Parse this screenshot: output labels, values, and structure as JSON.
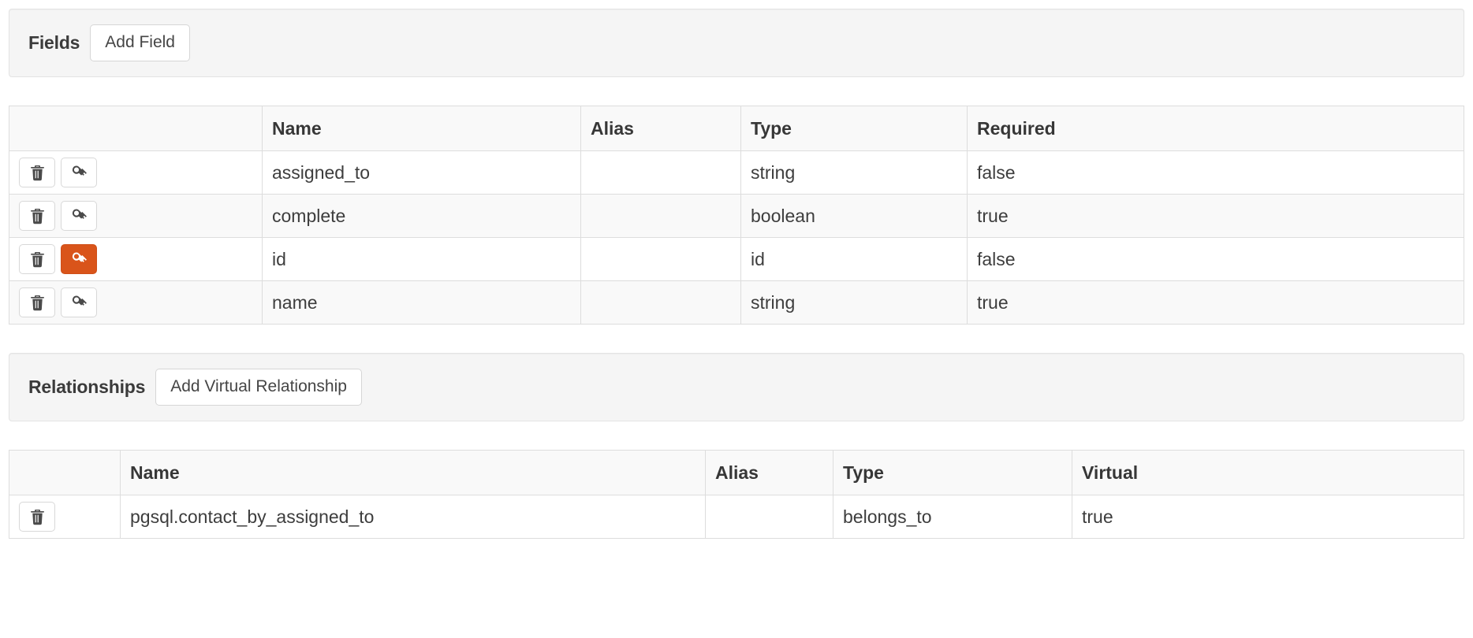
{
  "fields_section": {
    "title": "Fields",
    "add_button_label": "Add Field",
    "table": {
      "columns": [
        "",
        "Name",
        "Alias",
        "Type",
        "Required"
      ],
      "rows": [
        {
          "name": "assigned_to",
          "alias": "",
          "type": "string",
          "required": "false",
          "primary_key": false
        },
        {
          "name": "complete",
          "alias": "",
          "type": "boolean",
          "required": "true",
          "primary_key": false
        },
        {
          "name": "id",
          "alias": "",
          "type": "id",
          "required": "false",
          "primary_key": true
        },
        {
          "name": "name",
          "alias": "",
          "type": "string",
          "required": "true",
          "primary_key": false
        }
      ]
    }
  },
  "relationships_section": {
    "title": "Relationships",
    "add_button_label": "Add Virtual Relationship",
    "table": {
      "columns": [
        "",
        "Name",
        "Alias",
        "Type",
        "Virtual"
      ],
      "rows": [
        {
          "name": "pgsql.contact_by_assigned_to",
          "alias": "",
          "type": "belongs_to",
          "virtual": "true"
        }
      ]
    }
  },
  "icons": {
    "delete": "trash-icon",
    "primary_key": "key-icon"
  },
  "colors": {
    "accent": "#d9541a",
    "panel_bg": "#f5f5f5",
    "row_alt_bg": "#f9f9f9",
    "border": "#dddddd",
    "text": "#3d3d3d"
  }
}
